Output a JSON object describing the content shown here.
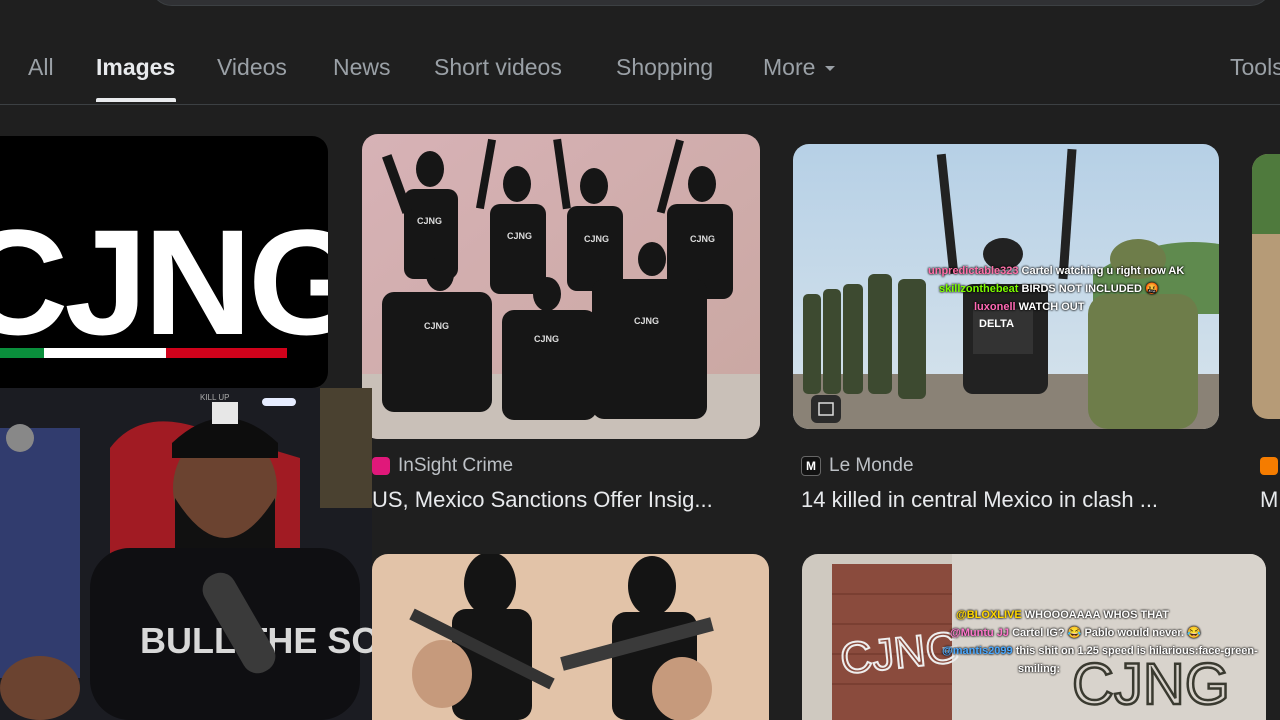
{
  "tabs": [
    {
      "label": "All"
    },
    {
      "label": "Images"
    },
    {
      "label": "Videos"
    },
    {
      "label": "News"
    },
    {
      "label": "Short videos"
    },
    {
      "label": "Shopping"
    },
    {
      "label": "More"
    }
  ],
  "tools_label": "Tools",
  "logo_card": {
    "text": "CJNG"
  },
  "results": [
    {
      "source": "InSight Crime",
      "title": "US, Mexico Sanctions Offer Insig..."
    },
    {
      "source": "Le Monde",
      "title": "14 killed in central Mexico in clash ..."
    },
    {
      "source": "",
      "title": "M"
    }
  ],
  "photo_labels": {
    "shirt_text": "CJNG",
    "vest_text": "DELTA",
    "graffiti_1": "CJNG",
    "graffiti_2": "CJNG"
  },
  "webcam": {
    "hat_text": "KILL UP",
    "shirt_text": "BULL THE SOUND"
  },
  "chat_overlay_top": [
    {
      "user": "unpredictable323",
      "message": "Cartel watching u right now AK"
    },
    {
      "user": "skillzonthebeat",
      "message": "BIRDS NOT INCLUDED 🤬"
    },
    {
      "user": "luxonell",
      "message": "WATCH OUT"
    }
  ],
  "chat_overlay_bottom": [
    {
      "user": "@BLOXLIVE",
      "message": "WHOOOAAAA WHOS THAT"
    },
    {
      "user": "@Muntu JJ",
      "message": "Cartel IG? 😂 Pablo would never. 😂"
    },
    {
      "user": "@mantis2099",
      "message": "this shit on 1.25 speed is hilarious:face-green-"
    },
    {
      "user": "",
      "message": "smiling:"
    }
  ],
  "colors": {
    "background": "#1f1f1f",
    "active_tab": "#e8eaed",
    "inactive_tab": "#9aa0a6",
    "flag_green": "#0a8f3c",
    "flag_white": "#ffffff",
    "flag_red": "#d0021b"
  }
}
